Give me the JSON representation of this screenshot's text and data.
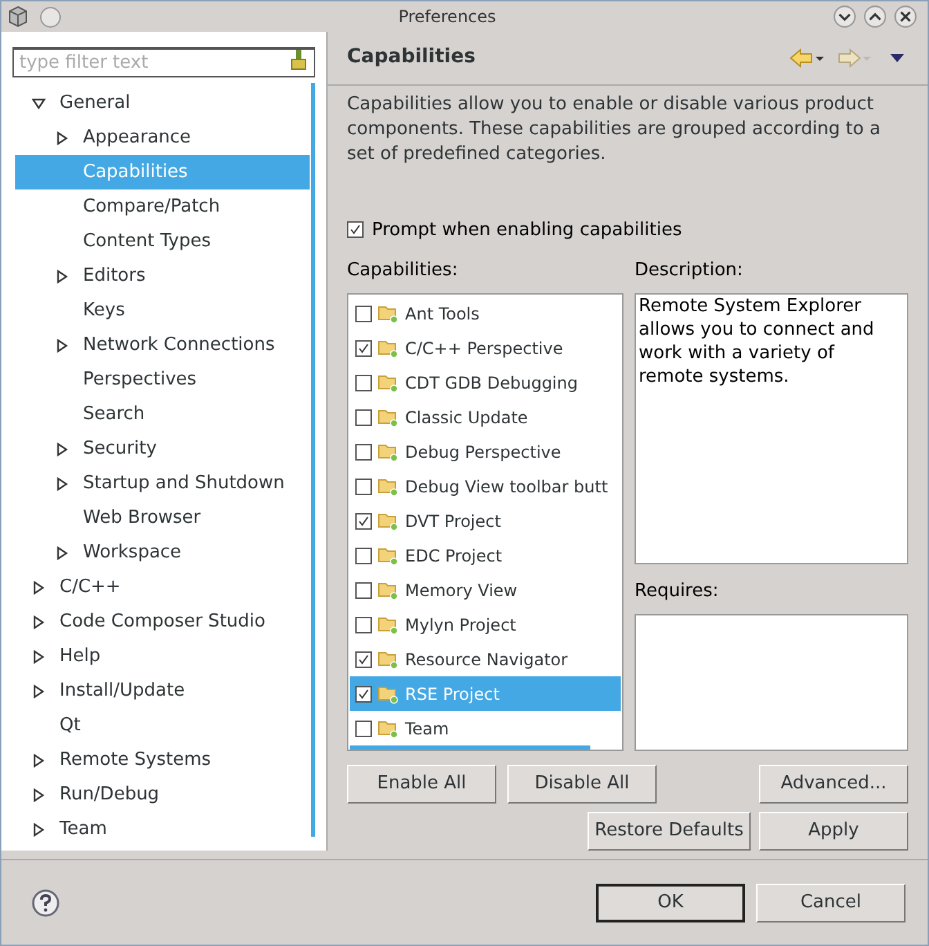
{
  "window": {
    "title": "Preferences"
  },
  "filter": {
    "placeholder": "type filter text"
  },
  "tree": [
    {
      "label": "General",
      "kind": "node",
      "expanded": true,
      "selected": false,
      "children": [
        {
          "label": "Appearance",
          "kind": "node",
          "expanded": false,
          "selected": false
        },
        {
          "label": "Capabilities",
          "kind": "leaf",
          "selected": true
        },
        {
          "label": "Compare/Patch",
          "kind": "leaf",
          "selected": false
        },
        {
          "label": "Content Types",
          "kind": "leaf",
          "selected": false
        },
        {
          "label": "Editors",
          "kind": "node",
          "expanded": false,
          "selected": false
        },
        {
          "label": "Keys",
          "kind": "leaf",
          "selected": false
        },
        {
          "label": "Network Connections",
          "kind": "node",
          "expanded": false,
          "selected": false
        },
        {
          "label": "Perspectives",
          "kind": "leaf",
          "selected": false
        },
        {
          "label": "Search",
          "kind": "leaf",
          "selected": false
        },
        {
          "label": "Security",
          "kind": "node",
          "expanded": false,
          "selected": false
        },
        {
          "label": "Startup and Shutdown",
          "kind": "node",
          "expanded": false,
          "selected": false
        },
        {
          "label": "Web Browser",
          "kind": "leaf",
          "selected": false
        },
        {
          "label": "Workspace",
          "kind": "node",
          "expanded": false,
          "selected": false
        }
      ]
    },
    {
      "label": "C/C++",
      "kind": "node",
      "expanded": false,
      "selected": false
    },
    {
      "label": "Code Composer Studio",
      "kind": "node",
      "expanded": false,
      "selected": false
    },
    {
      "label": "Help",
      "kind": "node",
      "expanded": false,
      "selected": false
    },
    {
      "label": "Install/Update",
      "kind": "node",
      "expanded": false,
      "selected": false
    },
    {
      "label": "Qt",
      "kind": "leaf",
      "selected": false
    },
    {
      "label": "Remote Systems",
      "kind": "node",
      "expanded": false,
      "selected": false
    },
    {
      "label": "Run/Debug",
      "kind": "node",
      "expanded": false,
      "selected": false
    },
    {
      "label": "Team",
      "kind": "node",
      "expanded": false,
      "selected": false
    }
  ],
  "page": {
    "title": "Capabilities",
    "intro": "Capabilities allow you to enable or disable various product components. These capabilities are grouped according to a set of predefined categories.",
    "prompt": {
      "label": "Prompt when enabling capabilities",
      "checked": true
    },
    "capabilities_label": "Capabilities:",
    "description_label": "Description:",
    "requires_label": "Requires:",
    "description": "Remote System Explorer allows you to connect and work with a variety of remote systems."
  },
  "capabilities": [
    {
      "name": "Ant Tools",
      "checked": false,
      "selected": false
    },
    {
      "name": "C/C++ Perspective",
      "checked": true,
      "selected": false
    },
    {
      "name": "CDT GDB Debugging",
      "checked": false,
      "selected": false
    },
    {
      "name": "Classic Update",
      "checked": false,
      "selected": false
    },
    {
      "name": "Debug Perspective",
      "checked": false,
      "selected": false
    },
    {
      "name": "Debug View toolbar butt",
      "checked": false,
      "selected": false
    },
    {
      "name": "DVT Project",
      "checked": true,
      "selected": false
    },
    {
      "name": "EDC Project",
      "checked": false,
      "selected": false
    },
    {
      "name": "Memory View",
      "checked": false,
      "selected": false
    },
    {
      "name": "Mylyn Project",
      "checked": false,
      "selected": false
    },
    {
      "name": "Resource Navigator",
      "checked": true,
      "selected": false
    },
    {
      "name": "RSE Project",
      "checked": true,
      "selected": true
    },
    {
      "name": "Team",
      "checked": false,
      "selected": false
    }
  ],
  "list_buttons": [
    "Enable All",
    "Disable All",
    "Advanced..."
  ],
  "page_buttons": [
    "Restore Defaults",
    "Apply"
  ],
  "dialog_buttons": [
    "OK",
    "Cancel"
  ]
}
